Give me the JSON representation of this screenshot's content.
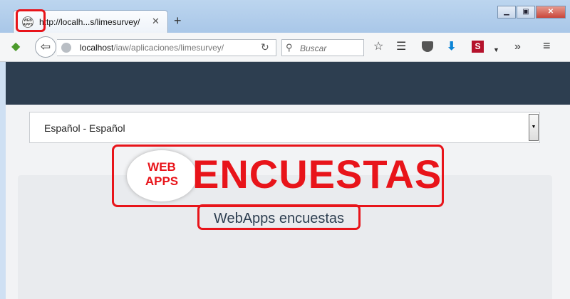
{
  "tab": {
    "title": "http://localh...s/limesurvey/",
    "favicon_text": "WEB APPS"
  },
  "toolbar": {
    "url_host": "localhost",
    "url_path": "/iaw/aplicaciones/limesurvey/",
    "search_placeholder": "Buscar"
  },
  "language_select": {
    "selected": "Español - Español"
  },
  "logo": {
    "cloud_line1": "WEB",
    "cloud_line2": "APPS",
    "word": "ENCUESTAS"
  },
  "site_title": "WebApps encuestas",
  "colors": {
    "header": "#2d3e50",
    "highlight": "#e8141a"
  }
}
